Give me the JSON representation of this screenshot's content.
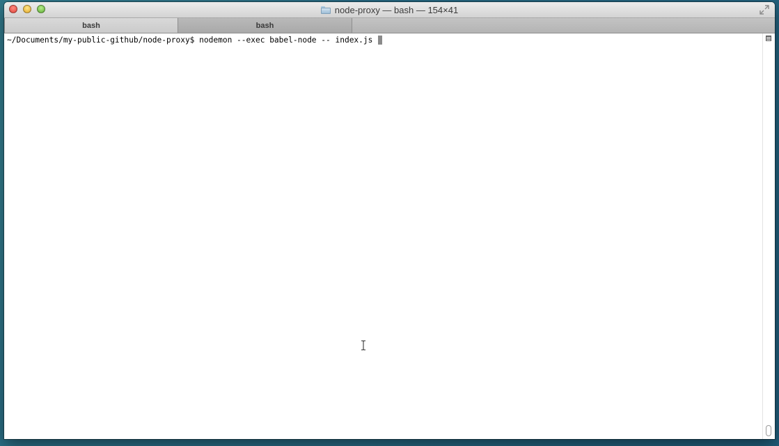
{
  "window": {
    "title": "node-proxy — bash — 154×41",
    "folder_icon": "folder-icon",
    "buttons": {
      "close": "close-icon",
      "minimize": "minimize-icon",
      "zoom": "zoom-icon",
      "fullscreen": "fullscreen-icon"
    }
  },
  "tabs": [
    {
      "label": "bash",
      "active": true
    },
    {
      "label": "bash",
      "active": false
    }
  ],
  "terminal": {
    "prompt": "~/Documents/my-public-github/node-proxy$ ",
    "command": "nodemon --exec babel-node -- index.js "
  },
  "colors": {
    "terminal_bg": "#ffffff",
    "terminal_text": "#000000",
    "cursor": "#8a8a8a",
    "close_button": "#e0443a",
    "minimize_button": "#e3a928",
    "zoom_button": "#5fae36"
  }
}
